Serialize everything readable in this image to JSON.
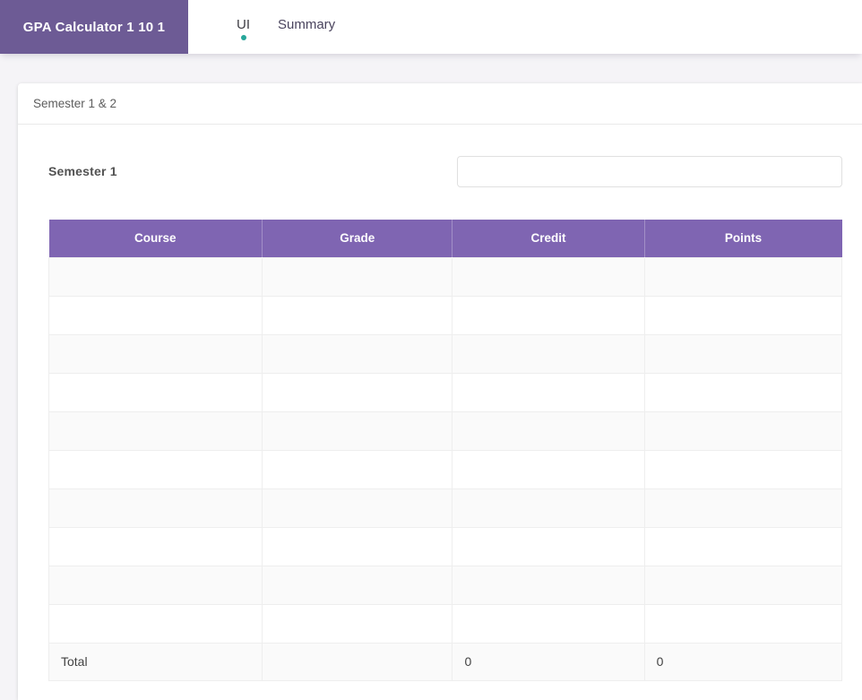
{
  "app_bar": {
    "title": "GPA Calculator 1 10 1",
    "tabs": [
      {
        "label": "UI",
        "active": true
      },
      {
        "label": "Summary",
        "active": false
      }
    ]
  },
  "panel": {
    "title": "Semester 1 & 2",
    "semester_label": "Semester 1",
    "semester_input": {
      "value": "",
      "placeholder": ""
    }
  },
  "table": {
    "columns": [
      "Course",
      "Grade",
      "Credit",
      "Points"
    ],
    "rows": [
      [
        "",
        "",
        "",
        ""
      ],
      [
        "",
        "",
        "",
        ""
      ],
      [
        "",
        "",
        "",
        ""
      ],
      [
        "",
        "",
        "",
        ""
      ],
      [
        "",
        "",
        "",
        ""
      ],
      [
        "",
        "",
        "",
        ""
      ],
      [
        "",
        "",
        "",
        ""
      ],
      [
        "",
        "",
        "",
        ""
      ],
      [
        "",
        "",
        "",
        ""
      ],
      [
        "",
        "",
        "",
        ""
      ]
    ],
    "cell_names": [
      "course-cell",
      "grade-cell",
      "credit-cell",
      "points-cell"
    ],
    "total": {
      "label": "Total",
      "grade": "",
      "credit": "0",
      "points": "0"
    }
  },
  "colors": {
    "app_bar_purple": "#6d5b95",
    "table_header_purple": "#7f65b2",
    "active_tab_dot": "#26a69a",
    "page_background": "#f5f4f7"
  }
}
